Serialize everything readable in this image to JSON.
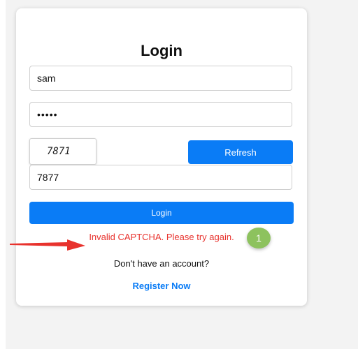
{
  "form": {
    "title": "Login",
    "username_value": "sam",
    "password_value": "•••••",
    "captcha_code": "7871",
    "refresh_label": "Refresh",
    "captcha_input_value": "7877",
    "login_label": "Login",
    "error_message": "Invalid CAPTCHA. Please try again.",
    "register_prompt": "Don't have an account?",
    "register_label": "Register Now"
  },
  "annotation": {
    "badge_number": "1",
    "badge_color": "#8dc25e",
    "arrow_color": "#e8322d",
    "arrow_icon": "red-arrow-icon"
  },
  "colors": {
    "accent": "#0a7cf6",
    "error": "#e8322d",
    "background": "#f3f3f3"
  }
}
